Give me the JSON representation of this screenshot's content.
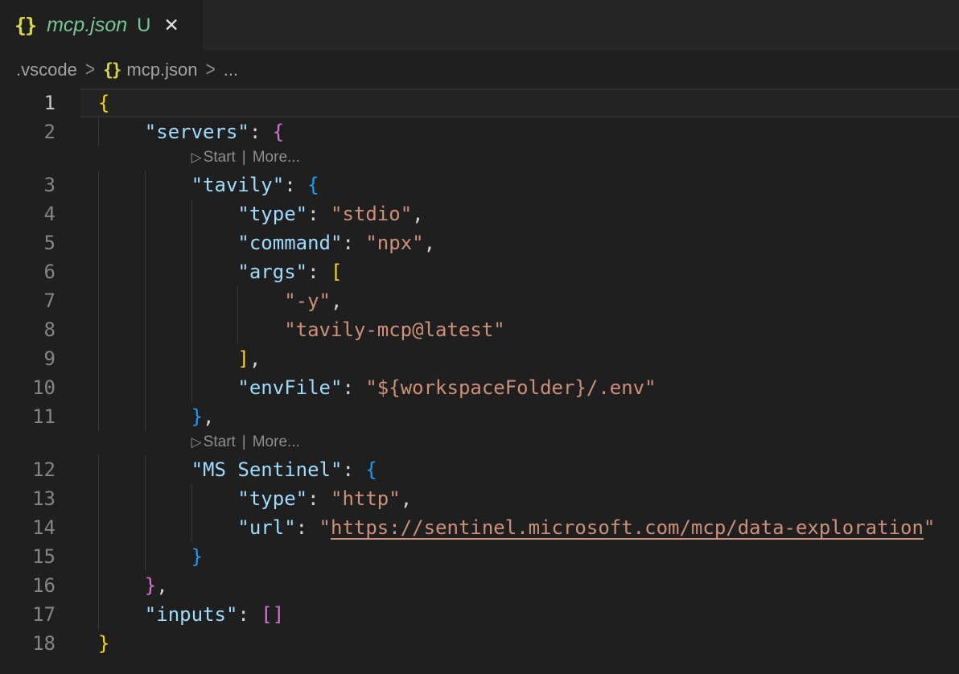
{
  "tab": {
    "icon": "{}",
    "title": "mcp.json",
    "git_status": "U",
    "close_icon": "✕"
  },
  "breadcrumb": {
    "folder": ".vscode",
    "separator": ">",
    "file_icon": "{}",
    "file": "mcp.json",
    "ellipsis": "..."
  },
  "codelens": {
    "run_icon": "▷",
    "start_label": "Start",
    "separator": "|",
    "more_label": "More..."
  },
  "colors": {
    "key": "#9cdcfe",
    "str": "#ce9178",
    "link": "#ce9178",
    "punct": "#d4d4d4",
    "b1": "#ffd700",
    "b2": "#da70d6",
    "b3": "#179fff",
    "ws": "#d4d4d4",
    "untracked_green": "#73c991",
    "json_icon_yellow": "#d6d64a",
    "editor_bg": "#1f1f1f",
    "tabbar_bg": "#262626"
  },
  "editor": {
    "lines": [
      {
        "type": "code",
        "num": "1",
        "current": true,
        "guides": [],
        "tokens": [
          {
            "t": "b1",
            "s": "{"
          }
        ]
      },
      {
        "type": "code",
        "num": "2",
        "guides": [
          0
        ],
        "tokens": [
          {
            "t": "ws",
            "s": "    "
          },
          {
            "t": "key",
            "s": "\"servers\""
          },
          {
            "t": "punct",
            "s": ": "
          },
          {
            "t": "b2",
            "s": "{"
          }
        ]
      },
      {
        "type": "codelens"
      },
      {
        "type": "code",
        "num": "3",
        "guides": [
          0,
          4
        ],
        "tokens": [
          {
            "t": "ws",
            "s": "        "
          },
          {
            "t": "key",
            "s": "\"tavily\""
          },
          {
            "t": "punct",
            "s": ": "
          },
          {
            "t": "b3",
            "s": "{"
          }
        ]
      },
      {
        "type": "code",
        "num": "4",
        "guides": [
          0,
          4,
          8
        ],
        "tokens": [
          {
            "t": "ws",
            "s": "            "
          },
          {
            "t": "key",
            "s": "\"type\""
          },
          {
            "t": "punct",
            "s": ": "
          },
          {
            "t": "str",
            "s": "\"stdio\""
          },
          {
            "t": "punct",
            "s": ","
          }
        ]
      },
      {
        "type": "code",
        "num": "5",
        "guides": [
          0,
          4,
          8
        ],
        "tokens": [
          {
            "t": "ws",
            "s": "            "
          },
          {
            "t": "key",
            "s": "\"command\""
          },
          {
            "t": "punct",
            "s": ": "
          },
          {
            "t": "str",
            "s": "\"npx\""
          },
          {
            "t": "punct",
            "s": ","
          }
        ]
      },
      {
        "type": "code",
        "num": "6",
        "guides": [
          0,
          4,
          8
        ],
        "tokens": [
          {
            "t": "ws",
            "s": "            "
          },
          {
            "t": "key",
            "s": "\"args\""
          },
          {
            "t": "punct",
            "s": ": "
          },
          {
            "t": "b1",
            "s": "["
          }
        ]
      },
      {
        "type": "code",
        "num": "7",
        "guides": [
          0,
          4,
          8,
          12
        ],
        "tokens": [
          {
            "t": "ws",
            "s": "                "
          },
          {
            "t": "str",
            "s": "\"-y\""
          },
          {
            "t": "punct",
            "s": ","
          }
        ]
      },
      {
        "type": "code",
        "num": "8",
        "guides": [
          0,
          4,
          8,
          12
        ],
        "tokens": [
          {
            "t": "ws",
            "s": "                "
          },
          {
            "t": "str",
            "s": "\"tavily-mcp@latest\""
          }
        ]
      },
      {
        "type": "code",
        "num": "9",
        "guides": [
          0,
          4,
          8
        ],
        "tokens": [
          {
            "t": "ws",
            "s": "            "
          },
          {
            "t": "b1",
            "s": "]"
          },
          {
            "t": "punct",
            "s": ","
          }
        ]
      },
      {
        "type": "code",
        "num": "10",
        "guides": [
          0,
          4,
          8
        ],
        "tokens": [
          {
            "t": "ws",
            "s": "            "
          },
          {
            "t": "key",
            "s": "\"envFile\""
          },
          {
            "t": "punct",
            "s": ": "
          },
          {
            "t": "str",
            "s": "\"${workspaceFolder}/.env\""
          }
        ]
      },
      {
        "type": "code",
        "num": "11",
        "guides": [
          0,
          4
        ],
        "tokens": [
          {
            "t": "ws",
            "s": "        "
          },
          {
            "t": "b3",
            "s": "}"
          },
          {
            "t": "punct",
            "s": ","
          }
        ]
      },
      {
        "type": "codelens"
      },
      {
        "type": "code",
        "num": "12",
        "guides": [
          0,
          4
        ],
        "tokens": [
          {
            "t": "ws",
            "s": "        "
          },
          {
            "t": "key",
            "s": "\"MS Sentinel\""
          },
          {
            "t": "punct",
            "s": ": "
          },
          {
            "t": "b3",
            "s": "{"
          }
        ]
      },
      {
        "type": "code",
        "num": "13",
        "guides": [
          0,
          4,
          8
        ],
        "tokens": [
          {
            "t": "ws",
            "s": "            "
          },
          {
            "t": "key",
            "s": "\"type\""
          },
          {
            "t": "punct",
            "s": ": "
          },
          {
            "t": "str",
            "s": "\"http\""
          },
          {
            "t": "punct",
            "s": ","
          }
        ]
      },
      {
        "type": "code",
        "num": "14",
        "guides": [
          0,
          4,
          8
        ],
        "tokens": [
          {
            "t": "ws",
            "s": "            "
          },
          {
            "t": "key",
            "s": "\"url\""
          },
          {
            "t": "punct",
            "s": ": "
          },
          {
            "t": "str",
            "s": "\""
          },
          {
            "t": "link",
            "s": "https://sentinel.microsoft.com/mcp/data-exploration"
          },
          {
            "t": "str",
            "s": "\""
          }
        ]
      },
      {
        "type": "code",
        "num": "15",
        "guides": [
          0,
          4
        ],
        "tokens": [
          {
            "t": "ws",
            "s": "        "
          },
          {
            "t": "b3",
            "s": "}"
          }
        ]
      },
      {
        "type": "code",
        "num": "16",
        "guides": [
          0
        ],
        "tokens": [
          {
            "t": "ws",
            "s": "    "
          },
          {
            "t": "b2",
            "s": "}"
          },
          {
            "t": "punct",
            "s": ","
          }
        ]
      },
      {
        "type": "code",
        "num": "17",
        "guides": [
          0
        ],
        "tokens": [
          {
            "t": "ws",
            "s": "    "
          },
          {
            "t": "key",
            "s": "\"inputs\""
          },
          {
            "t": "punct",
            "s": ": "
          },
          {
            "t": "b2",
            "s": "[]"
          }
        ]
      },
      {
        "type": "code",
        "num": "18",
        "guides": [],
        "tokens": [
          {
            "t": "b1",
            "s": "}"
          }
        ]
      }
    ]
  }
}
